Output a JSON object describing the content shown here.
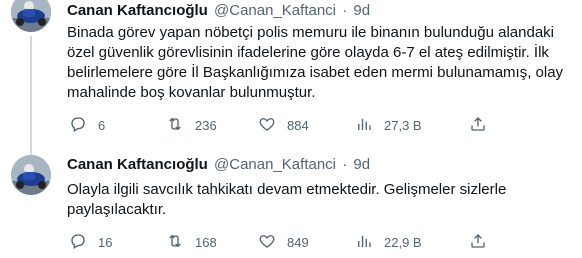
{
  "tweets": [
    {
      "author_name": "Canan Kaftancıoğlu",
      "author_handle": "@Canan_Kaftanci",
      "separator": "·",
      "time": "9d",
      "text": "Binada görev yapan nöbetçi polis memuru ile binanın bulunduğu alandaki özel güvenlik görevlisinin ifadelerine göre olayda 6-7 el ateş edilmiştir. İlk belirlemelere göre İl Başkanlığımıza isabet eden mermi bulunamamış, olay mahalinde boş kovanlar bulunmuştur.",
      "replies": "6",
      "retweets": "236",
      "likes": "884",
      "views": "27,3 B"
    },
    {
      "author_name": "Canan Kaftancıoğlu",
      "author_handle": "@Canan_Kaftanci",
      "separator": "·",
      "time": "9d",
      "text": "Olayla ilgili savcılık tahkikatı devam etmektedir. Gelişmeler sizlerle paylaşılacaktır.",
      "replies": "16",
      "retweets": "168",
      "likes": "849",
      "views": "22,9 B"
    }
  ],
  "icons": {
    "reply": "reply-icon",
    "retweet": "retweet-icon",
    "like": "heart-icon",
    "views": "bar-chart-icon",
    "share": "share-icon"
  },
  "colors": {
    "text": "#0f1419",
    "muted": "#536471",
    "thread_line": "#cfd9de"
  }
}
